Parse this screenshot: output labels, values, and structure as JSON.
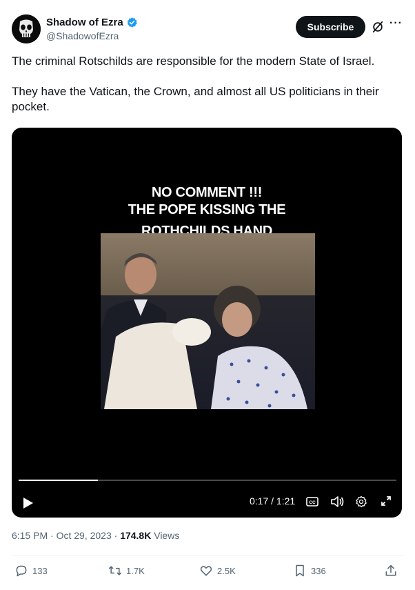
{
  "author": {
    "display_name": "Shadow of Ezra",
    "handle": "@ShadowofEzra"
  },
  "header": {
    "subscribe_label": "Subscribe",
    "more_label": "···"
  },
  "tweet": {
    "text": "The criminal Rotschilds are responsible for the modern State of Israel.\n\nThey have the Vatican, the Crown, and almost all US politicians in their pocket."
  },
  "video": {
    "overlay_line1": "NO COMMENT !!!",
    "overlay_line2": "THE POPE KISSING THE",
    "overlay_line3": "ROTHCHILDS HAND",
    "time_display": "0:17 / 1:21",
    "progress_fraction": 0.21
  },
  "meta": {
    "timestamp": "6:15 PM · Oct 29, 2023 · ",
    "views_count": "174.8K",
    "views_label": " Views"
  },
  "actions": {
    "replies": "133",
    "reposts": "1.7K",
    "likes": "2.5K",
    "bookmarks": "336"
  },
  "colors": {
    "accent": "#1d9bf0",
    "text": "#0f1419",
    "muted": "#536471"
  }
}
